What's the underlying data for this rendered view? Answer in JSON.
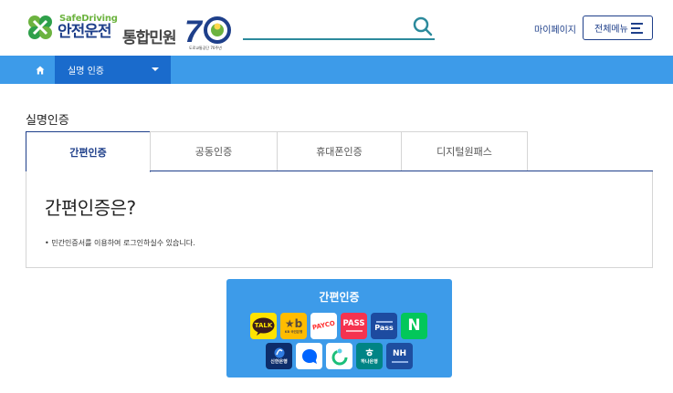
{
  "header": {
    "logo_en": "SafeDriving",
    "logo_ko": "안전운전",
    "logo_sub": "통합민원",
    "anniv_number": "70",
    "anniv_caption": "도로교통공단 70주년",
    "mypage_label": "마이페이지",
    "allmenu_label": "전체메뉴",
    "search_icon": "search-icon",
    "menu_icon": "hamburger-icon"
  },
  "nav": {
    "home_icon": "home-icon",
    "current": "실명 인증"
  },
  "page": {
    "title": "실명인증"
  },
  "tabs": [
    {
      "label": "간편인증",
      "active": true
    },
    {
      "label": "공동인증",
      "active": false
    },
    {
      "label": "휴대폰인증",
      "active": false
    },
    {
      "label": "디지털원패스",
      "active": false
    }
  ],
  "content": {
    "heading": "간편인증은?",
    "bullet": "민간인증서를 이용하여 로그인하실수 있습니다."
  },
  "auth_panel": {
    "title": "간편인증",
    "providers": [
      {
        "name": "kakao",
        "text": "TALK",
        "bg": "#ffe300",
        "fg": "#3a1d1d"
      },
      {
        "name": "kb",
        "text": "KB 국민은행",
        "bg": "#ffbc00",
        "fg": "#594a3c"
      },
      {
        "name": "payco",
        "text": "PAYCO",
        "bg": "#ffffff",
        "fg": "#ff2f2f"
      },
      {
        "name": "pass",
        "text": "PASS",
        "bg": "#f5334f",
        "fg": "#ffffff"
      },
      {
        "name": "samsung-pass",
        "text": "Pass",
        "bg": "#1d4ba0",
        "fg": "#ffffff"
      },
      {
        "name": "naver",
        "text": "N",
        "bg": "#03c75a",
        "fg": "#ffffff"
      },
      {
        "name": "shinhan",
        "text": "신한은행",
        "bg": "#0d2d6b",
        "fg": "#ffffff"
      },
      {
        "name": "toss",
        "text": "",
        "bg": "#ffffff",
        "fg": "#0064ff"
      },
      {
        "name": "banksalad",
        "text": "",
        "bg": "#ffffff",
        "fg": "#1cbf7a"
      },
      {
        "name": "hana",
        "text": "하나은행",
        "bg": "#008485",
        "fg": "#ffffff"
      },
      {
        "name": "nh",
        "text": "NH",
        "bg": "#1e4ea0",
        "fg": "#ffffff"
      }
    ]
  }
}
